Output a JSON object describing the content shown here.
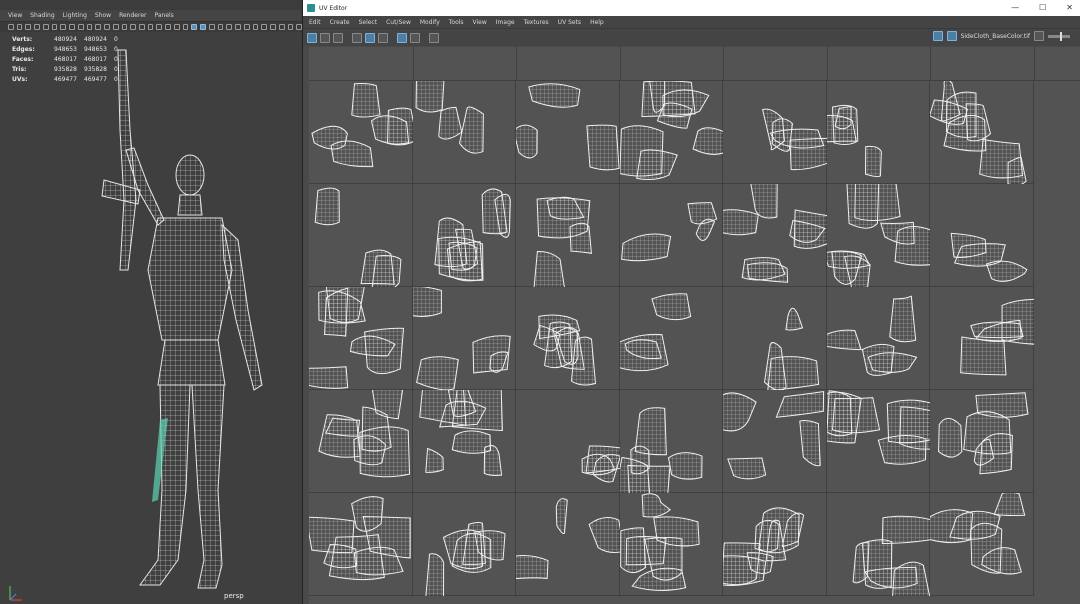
{
  "viewport": {
    "menu": [
      "View",
      "Shading",
      "Lighting",
      "Show",
      "Renderer",
      "Panels"
    ],
    "hud": [
      {
        "label": "Verts:",
        "a": "480924",
        "b": "480924",
        "c": "0"
      },
      {
        "label": "Edges:",
        "a": "948653",
        "b": "948653",
        "c": "0"
      },
      {
        "label": "Faces:",
        "a": "468017",
        "b": "468017",
        "c": "0"
      },
      {
        "label": "Tris:",
        "a": "935828",
        "b": "935828",
        "c": "0"
      },
      {
        "label": "UVs:",
        "a": "469477",
        "b": "469477",
        "c": "0"
      }
    ],
    "camera_label": "persp",
    "wire_color": "#e6e6e6",
    "select_color": "#5fd3b3"
  },
  "uv_editor": {
    "title": "UV Editor",
    "window_controls": [
      "—",
      "☐",
      "✕"
    ],
    "menu": [
      "Edit",
      "Create",
      "Select",
      "Cut/Sew",
      "Modify",
      "Tools",
      "View",
      "Image",
      "Textures",
      "UV Sets",
      "Help"
    ],
    "texture_name": "SideCloth_BaseColor.tif",
    "grid_rows": 5,
    "grid_cols": 7,
    "accent_color": "#4d7ea3",
    "title_icon_color": "#2d8f8a"
  }
}
